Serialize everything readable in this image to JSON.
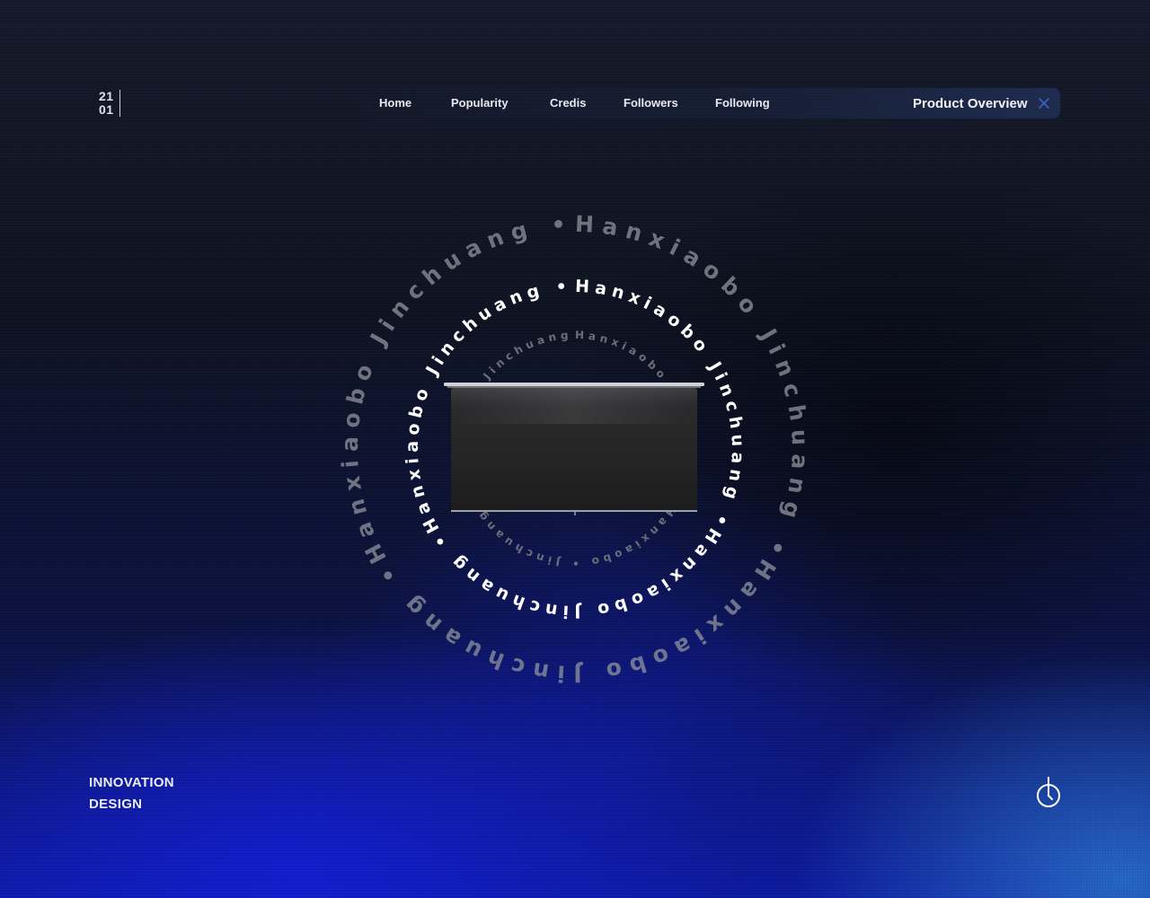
{
  "date": {
    "day": "21",
    "month": "01"
  },
  "nav": {
    "items": [
      {
        "label": "Home"
      },
      {
        "label": "Popularity"
      },
      {
        "label": "Credis"
      },
      {
        "label": "Followers"
      },
      {
        "label": "Following"
      }
    ],
    "active_tab": "Product Overview"
  },
  "rings": {
    "outer": "Hanxiaobo Jinchuang •Hanxiaobo Jinchuang •Hanxiaobo Jinchuang •",
    "middle": "Hanxiaobo Jinchuang •Hanxiaobo Jinchuang •Hanxiaobo Jinchuang •",
    "inner": "Hanxiaobo • Jinchuang  Hanxiaobo • Jinchuang  Hanxiaobo • Jinchuang"
  },
  "badge": {
    "line1": "INNOVATION",
    "line2": "DESIGN"
  },
  "icons": {
    "close": "close-icon",
    "power": "power-icon"
  },
  "colors": {
    "accent_blue": "#1a2ad8",
    "ring_outer": "#8a8e99",
    "ring_middle": "#ffffff",
    "ring_inner": "#6b6f7a"
  }
}
